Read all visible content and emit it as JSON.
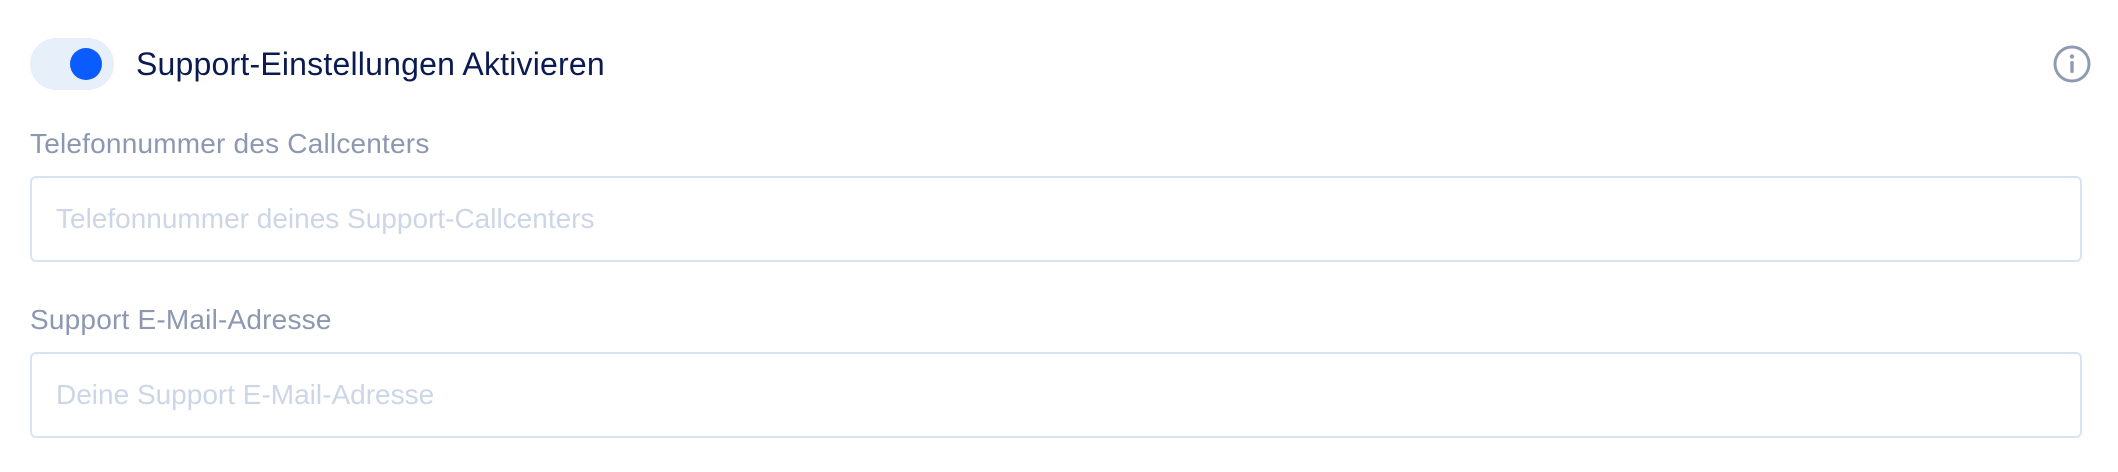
{
  "support": {
    "toggle_label": "Support-Einstellungen Aktivieren",
    "toggle_on": true,
    "icons": {
      "info": "info-icon"
    },
    "phone": {
      "label": "Telefonnummer des Callcenters",
      "value": "",
      "placeholder": "Telefonnummer deines Support-Callcenters"
    },
    "email": {
      "label": "Support E-Mail-Adresse",
      "value": "",
      "placeholder": "Deine Support E-Mail-Adresse"
    }
  },
  "colors": {
    "accent": "#0b5cff",
    "toggle_track": "#e7effb",
    "title_text": "#0b1b52",
    "label_text": "#8c97b1",
    "placeholder_text": "#cdd6e6",
    "input_border": "#d8e3f3",
    "icon": "#8f9ab3"
  }
}
